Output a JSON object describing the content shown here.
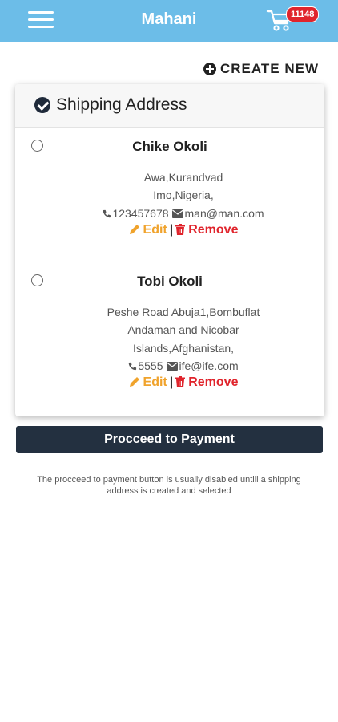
{
  "header": {
    "title": "Mahani",
    "cart_count": "11148",
    "menu_icon": "hamburger-icon",
    "cart_icon": "cart-icon",
    "bar_color": "#6cbde8"
  },
  "create_new_label": "CREATE NEW",
  "card": {
    "title": "Shipping Address",
    "addresses": [
      {
        "name": "Chike Okoli",
        "lines": [
          "Awa,Kurandvad",
          "Imo,Nigeria,"
        ],
        "phone": "123457678",
        "email": "man@man.com",
        "edit_label": "Edit",
        "remove_label": "Remove"
      },
      {
        "name": "Tobi Okoli",
        "lines": [
          "Peshe Road Abuja1,Bombuflat",
          "Andaman and Nicobar",
          "Islands,Afghanistan,"
        ],
        "phone": "5555",
        "email": "ife@ife.com",
        "edit_label": "Edit",
        "remove_label": "Remove"
      }
    ],
    "separator": "|"
  },
  "proceed_label": "Procceed to Payment",
  "note": "The procceed to payment button is usually disabled untill a shipping address is created and selected",
  "colors": {
    "edit": "#f0a32c",
    "remove": "#e0242c",
    "button": "#233040",
    "badge": "#e0242c"
  }
}
